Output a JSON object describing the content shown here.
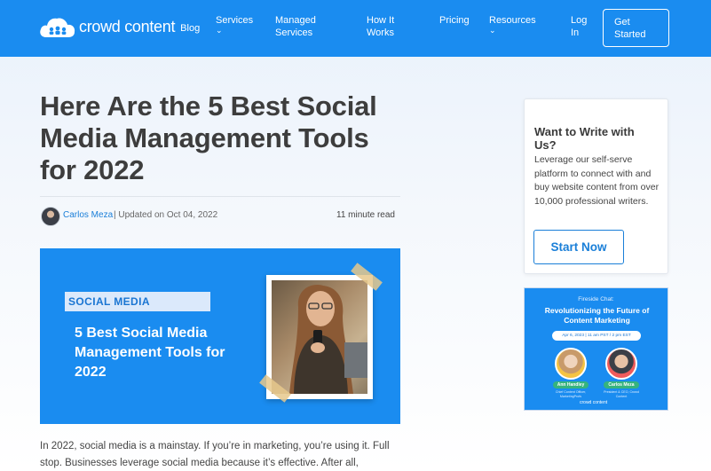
{
  "colors": {
    "brand": "#1a8cf0",
    "link": "#1a7fd8",
    "title": "#3d3d3d"
  },
  "nav": {
    "logo_text": "crowd content",
    "logo_suffix": "Blog",
    "items": [
      {
        "line1": "Services",
        "line2": "",
        "caret": "⌄"
      },
      {
        "line1": "Managed",
        "line2": "Services",
        "caret": ""
      },
      {
        "line1": "How It",
        "line2": "Works",
        "caret": ""
      },
      {
        "line1": "Pricing",
        "line2": "",
        "caret": ""
      },
      {
        "line1": "Resources",
        "line2": "",
        "caret": "⌄"
      },
      {
        "line1": "Log",
        "line2": "In",
        "caret": ""
      }
    ],
    "cta": {
      "line1": "Get",
      "line2": "Started"
    }
  },
  "article": {
    "title": "Here Are the 5 Best Social Media Management Tools for 2022",
    "author": "Carlos Meza",
    "updated": "| Updated on Oct 04, 2022",
    "read_time": "11 minute read",
    "hero": {
      "tag": "SOCIAL MEDIA",
      "title": "5 Best Social Media Management Tools for 2022"
    },
    "intro": "In 2022, social media is a mainstay. If you’re in marketing, you’re using it. Full stop. Businesses leverage social media because it’s effective. After all,"
  },
  "sidebar": {
    "card": {
      "title": "Want to Write with Us?",
      "text": "Leverage our self-serve platform to connect with and buy website content from over 10,000 professional writers.",
      "button": "Start Now"
    },
    "promo": {
      "kicker": "Fireside Chat:",
      "title": "Revolutionizing the Future of Content Marketing",
      "date": "Apr 6, 2023 | 11 am PST / 2 pm EST",
      "speakers": [
        {
          "name": "Ann Handley",
          "role": "Chief Content Officer, MarketingProfs"
        },
        {
          "name": "Carlos Meza",
          "role": "President & CEO, Crowd Content"
        }
      ],
      "logo": "crowd content"
    }
  }
}
